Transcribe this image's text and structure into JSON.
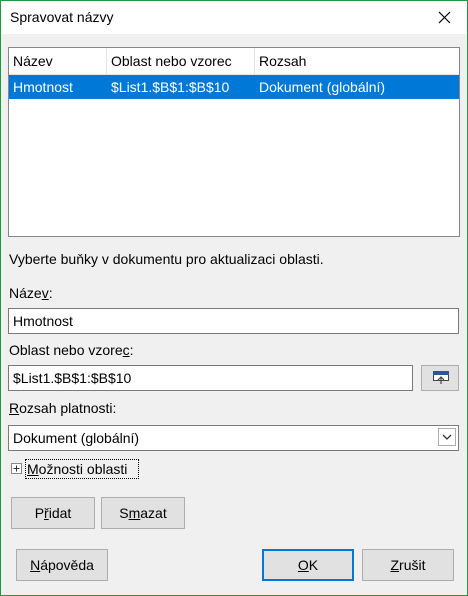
{
  "window": {
    "title": "Spravovat názvy"
  },
  "table": {
    "columns": [
      "Název",
      "Oblast nebo vzorec",
      "Rozsah"
    ],
    "rows": [
      {
        "name": "Hmotnost",
        "range": "$List1.$B$1:$B$10",
        "scope": "Dokument (globální)"
      }
    ]
  },
  "hint": "Vyberte buňky v dokumentu pro aktualizaci oblasti.",
  "name_field": {
    "label_pre": "Náze",
    "label_key": "v",
    "label_post": ":",
    "value": "Hmotnost"
  },
  "range_field": {
    "label_pre": "Oblast nebo vzore",
    "label_key": "c",
    "label_post": ":",
    "value": "$List1.$B$1:$B$10"
  },
  "scope_field": {
    "label_key": "R",
    "label_post": "ozsah platnosti:",
    "value": "Dokument (globální)"
  },
  "options": {
    "label_pre": "",
    "label_key": "M",
    "label_post": "ožnosti oblasti"
  },
  "buttons": {
    "add": {
      "pre": "P",
      "key": "ř",
      "post": "idat"
    },
    "delete": {
      "pre": "S",
      "key": "m",
      "post": "azat"
    },
    "help": {
      "pre": "",
      "key": "N",
      "post": "ápověda"
    },
    "ok": {
      "pre": "",
      "key": "O",
      "post": "K"
    },
    "cancel": {
      "pre": "",
      "key": "Z",
      "post": "rušit"
    }
  }
}
